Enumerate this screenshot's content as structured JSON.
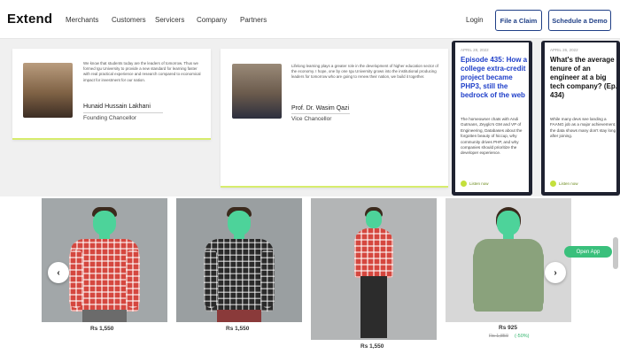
{
  "nav": {
    "logo": "Extend",
    "links": [
      "Merchants",
      "Customers",
      "Servicers",
      "Company",
      "Partners"
    ],
    "login": "Login",
    "file_claim": "File a Claim",
    "schedule_demo": "Schedule a Demo"
  },
  "chancellors": [
    {
      "text": "We know that students today are the leaders of tomorrow. Thus we formed Igu University to provide a new standard for learning faster with real practical experience and research compared to economical impact for investment for our nation.",
      "name": "Hunaid Hussain Lakhani",
      "role": "Founding Chancellor"
    },
    {
      "text": "Lifelong learning plays a greater role in the development of higher education sector of the economy. I hope, one by one Igu University grows into the institutional producing leaders for tomorrow who are going to renew their nation, we build it together.",
      "name": "Prof. Dr. Wasim Qazi",
      "role": "Vice Chancellor"
    }
  ],
  "articles": [
    {
      "date": "APRIL 28, 2022",
      "title": "Episode 435: How a college extra-credit project became PHP3, still the bedrock of the web",
      "body": "The homeowner chats with Andi Gutmans, Zeyglo's GM and VP of Engineering, Databases about the forgotten beauty of hiccup, why community drives PHP, and why companies should prioritize the developer experience.",
      "listen": "Listen now",
      "title_color": "#1f3fc9"
    },
    {
      "date": "APRIL 26, 2022",
      "title": "What's the average tenure of an engineer at a big tech company? (Ep. 434)",
      "body": "While many devs see landing a FAANG job as a major achievement, the data shows many don't stay long after joining.",
      "listen": "Listen now",
      "title_color": "#111111"
    }
  ],
  "products": [
    {
      "price": "Rs 1,550",
      "shirt": "plaid-red",
      "pants": "#6b6b6b",
      "bg": "#a2a7a9"
    },
    {
      "price": "Rs 1,550",
      "shirt": "plaid-black",
      "pants": "#8a3a3a",
      "bg": "#9a9fa1"
    },
    {
      "price": "Rs 1,550",
      "shirt": "plaid-red",
      "pants": "#2c2c2c",
      "bg": "#b3b5b6"
    },
    {
      "price": "Rs 925",
      "old_price": "Rs 1,850",
      "discount": "(-50%)",
      "shirt": "olive",
      "pants": "#8aa27c",
      "bg": "#d7d7d7"
    }
  ],
  "carousel": {
    "prev": "‹",
    "next": "›"
  },
  "open_app": "Open App",
  "colors": {
    "brand": "#1f3f86",
    "accent_green": "#3ac07c",
    "card_underline": "#d7ec6d",
    "face_mask": "#4dd39a"
  }
}
